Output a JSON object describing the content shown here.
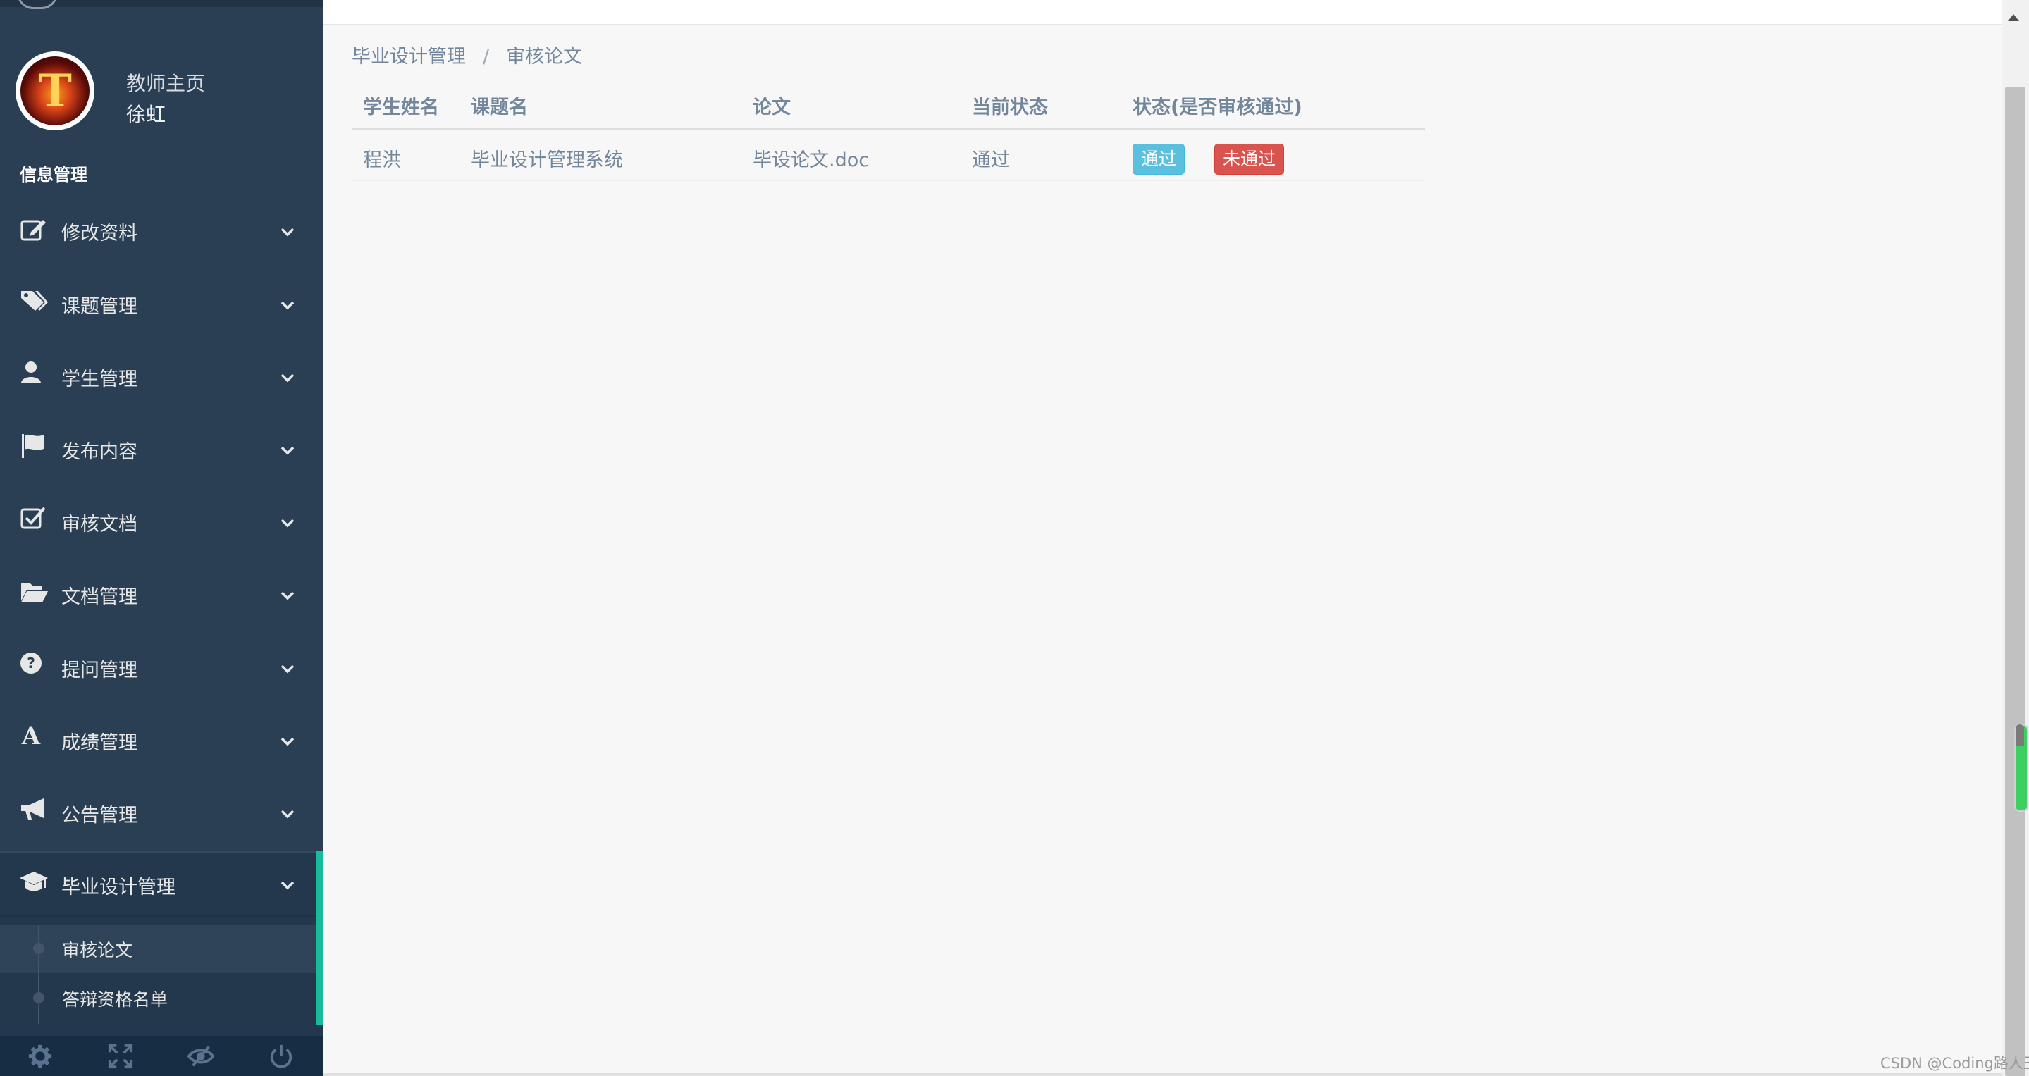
{
  "sidebar": {
    "profile": {
      "welcome": "教师主页",
      "name": "徐虹"
    },
    "section_title": "信息管理",
    "menu": [
      {
        "label": "修改资料",
        "icon": "edit-icon"
      },
      {
        "label": "课题管理",
        "icon": "tags-icon"
      },
      {
        "label": "学生管理",
        "icon": "user-icon"
      },
      {
        "label": "发布内容",
        "icon": "flag-icon"
      },
      {
        "label": "审核文档",
        "icon": "check-square-icon"
      },
      {
        "label": "文档管理",
        "icon": "folder-open-icon"
      },
      {
        "label": "提问管理",
        "icon": "question-circle-icon"
      },
      {
        "label": "成绩管理",
        "icon": "font-icon"
      },
      {
        "label": "公告管理",
        "icon": "bullhorn-icon"
      },
      {
        "label": "毕业设计管理",
        "icon": "graduation-cap-icon"
      }
    ],
    "submenu": [
      {
        "label": "审核论文",
        "active": true
      },
      {
        "label": "答辩资格名单",
        "active": false
      }
    ],
    "footer_icons": [
      "settings-icon",
      "fullscreen-icon",
      "lock-icon",
      "logout-icon"
    ]
  },
  "breadcrumb": {
    "parent": "毕业设计管理",
    "separator": "/",
    "current": "审核论文"
  },
  "table": {
    "headers": [
      "学生姓名",
      "课题名",
      "论文",
      "当前状态",
      "状态(是否审核通过)"
    ],
    "rows": [
      {
        "student": "程洪",
        "topic": "毕业设计管理系统",
        "paper": "毕设论文.doc",
        "status": "通过",
        "pass_label": "通过",
        "fail_label": "未通过"
      }
    ]
  },
  "watermark": "CSDN @Coding路人王",
  "colors": {
    "sidebar": "#2a3f54",
    "accent": "#1abb9c",
    "info_button": "#5bc0de",
    "danger_button": "#d9534f"
  }
}
